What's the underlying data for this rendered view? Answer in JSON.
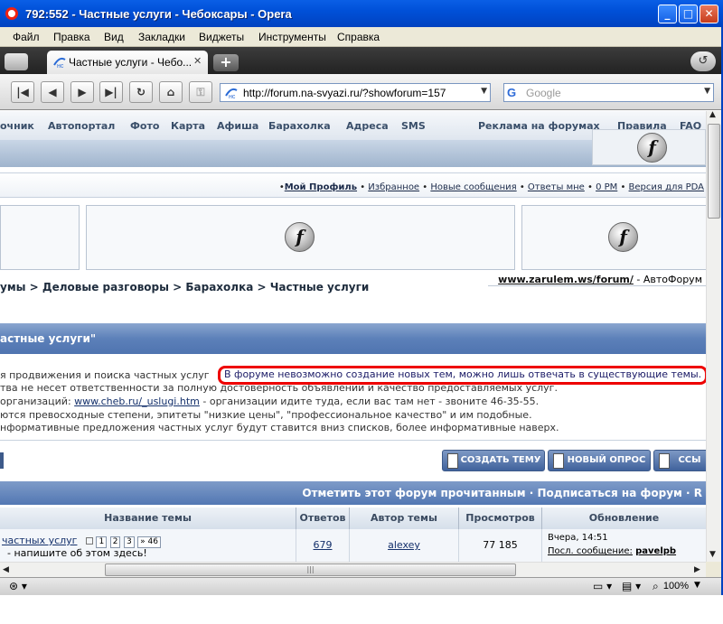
{
  "window": {
    "title": "792:552 - Частные услуги - Чебоксары - Opera",
    "min_glyph": "_",
    "max_glyph": "□",
    "close_glyph": "✕"
  },
  "menu": [
    "Файл",
    "Правка",
    "Вид",
    "Закладки",
    "Виджеты",
    "Инструменты",
    "Справка"
  ],
  "tab": {
    "label": "Частные услуги - Чебо...",
    "close_glyph": "✕"
  },
  "toolbar": {
    "new_tab_glyph": "+",
    "trash_glyph": "↺",
    "nav_glyphs": [
      "|◀",
      "◀",
      "▶",
      "▶|",
      "↻",
      "⌂",
      "⚿"
    ],
    "url": "http://forum.na-svyazi.ru/?showforum=157",
    "search_placeholder": "Google",
    "search_logo": "G"
  },
  "page": {
    "topnav": [
      "очник",
      "Автопортал",
      "Фото",
      "Карта",
      "Афиша",
      "Барахолка",
      "Адреса",
      "SMS",
      "Реклама на форумах",
      "Правила",
      "FAQ"
    ],
    "flash_glyph": "f",
    "userbar_links": [
      "Мой Профиль",
      "Избранное",
      "Новые сообщения",
      "Ответы мне",
      "0 PM",
      "Версия для PDA"
    ],
    "breadcrumb": "умы > Деловые разговоры > Барахолка > Частные услуги",
    "partner_link": "www.zarulem.ws/forum/",
    "partner_text": " - АвтоФорум",
    "forum_title": "астные услуги\"",
    "rules": {
      "line1": "я продвижения и поиска частных услуг",
      "highlight": "В форуме невозможно создание новых тем, можно лишь отвечать в существующие темы.",
      "line2": "тва не несет ответственности за полную достоверность объявлений и качество предоставляемых услуг.",
      "line3_pre": " организаций: ",
      "line3_link": "www.cheb.ru/_uslugi.htm",
      "line3_post": " - организации идите туда, если вас там нет - звоните 46-35-55.",
      "line4": "ются превосходные степени, эпитеты \"низкие цены\", \"профессиональное качество\" и им подобные.",
      "line5": "нформативные предложения частных услуг будут ставится вниз списков, более информативные наверх."
    },
    "buttons": {
      "create_topic": "СОЗДАТЬ ТЕМУ",
      "new_poll": "НОВЫЙ ОПРОС",
      "link": "ССЫ"
    },
    "table_top_links": "Отметить этот форум прочитанным · Подписаться на форум · R",
    "table": {
      "headers": [
        "Название темы",
        "Ответов",
        "Автор темы",
        "Просмотров",
        "Обновление"
      ],
      "row1": {
        "title": "частных услуг",
        "pages": [
          "1",
          "2",
          "3",
          "» 46"
        ],
        "subtitle": "- напишите об этом здесь!",
        "replies": "679",
        "author": "alexey",
        "views": "77 185",
        "updated": "Вчера, 14:51",
        "last_label": "Посл. сообщение:",
        "last_user": "pavelpb"
      }
    }
  },
  "status": {
    "zoom": "100%"
  }
}
